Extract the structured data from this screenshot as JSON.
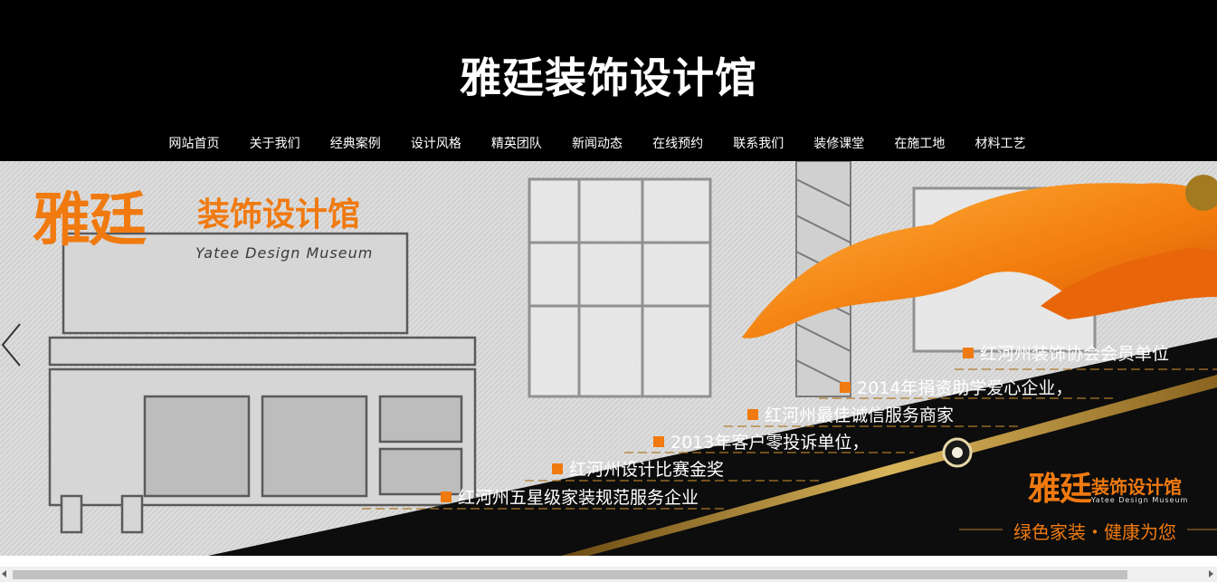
{
  "header": {
    "site_title": "雅廷装饰设计馆"
  },
  "nav": {
    "items": [
      {
        "label": "网站首页"
      },
      {
        "label": "关于我们"
      },
      {
        "label": "经典案例"
      },
      {
        "label": "设计风格"
      },
      {
        "label": "精英团队"
      },
      {
        "label": "新闻动态"
      },
      {
        "label": "在线预约"
      },
      {
        "label": "联系我们"
      },
      {
        "label": "装修课堂"
      },
      {
        "label": "在施工地"
      },
      {
        "label": "材料工艺"
      }
    ]
  },
  "banner": {
    "brand_cn_big": "雅廷",
    "brand_cn_small": "装饰设计馆",
    "brand_en": "Yatee Design Museum",
    "honors": [
      "红河州装饰协会会员单位",
      "2014年捐资助学爱心企业，",
      "红河州最佳诚信服务商家",
      "2013年客户零投诉单位，",
      "红河州设计比赛金奖",
      "红河州五星级家装规范服务企业"
    ],
    "logo2_cn_big": "雅廷",
    "logo2_cn_small": "装饰设计馆",
    "logo2_en": "Yatee Design Museum",
    "slogan": "绿色家装・健康为您"
  },
  "colors": {
    "accent": "#f07a10",
    "header_bg": "#000000"
  },
  "icons": {
    "prev": "chevron-left-icon",
    "scroll_left": "scroll-left-arrow-icon",
    "scroll_right": "scroll-right-arrow-icon"
  }
}
